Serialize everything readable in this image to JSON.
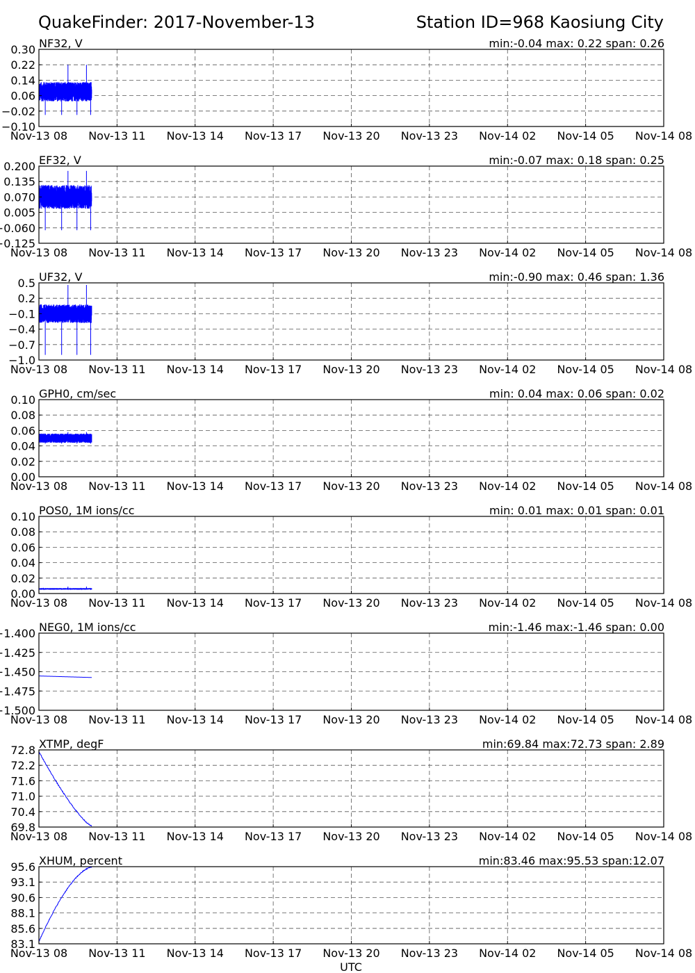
{
  "header": {
    "title": "QuakeFinder: 2017-November-13",
    "station": "Station ID=968  Kaosiung City"
  },
  "x_ticks": [
    "Nov-13 08",
    "Nov-13 11",
    "Nov-13 14",
    "Nov-13 17",
    "Nov-13 20",
    "Nov-13 23",
    "Nov-14 02",
    "Nov-14 05",
    "Nov-14 08"
  ],
  "xlabel": "UTC",
  "colors": {
    "series": "#0000ff",
    "grid": "#555555",
    "axis": "#000000"
  },
  "chart_data": [
    {
      "type": "line",
      "channel": "NF32, V",
      "stats": "min:-0.04 max: 0.22 span: 0.26",
      "yticks": [
        "0.30",
        "0.22",
        "0.14",
        "0.06",
        "−0.02",
        "−0.10"
      ],
      "ylim": [
        -0.1,
        0.3
      ],
      "x": "Nov-13 08 to ~Nov-13 10:40",
      "band": {
        "min": 0.03,
        "max": 0.13,
        "spike_min": -0.04,
        "spike_max": 0.22
      },
      "style": "noise"
    },
    {
      "type": "line",
      "channel": "EF32, V",
      "stats": "min:-0.07 max: 0.18 span: 0.25",
      "yticks": [
        "0.200",
        "0.135",
        "0.070",
        "0.005",
        "−0.060",
        "−0.125"
      ],
      "ylim": [
        -0.125,
        0.2
      ],
      "x": "Nov-13 08 to ~Nov-13 10:40",
      "band": {
        "min": 0.02,
        "max": 0.12,
        "spike_min": -0.07,
        "spike_max": 0.18
      },
      "style": "noise"
    },
    {
      "type": "line",
      "channel": "UF32, V",
      "stats": "min:-0.90 max: 0.46 span: 1.36",
      "yticks": [
        "0.5",
        "0.2",
        "−0.1",
        "−0.4",
        "−0.7",
        "−1.0"
      ],
      "ylim": [
        -1.0,
        0.5
      ],
      "x": "Nov-13 08 to ~Nov-13 10:40",
      "band": {
        "min": -0.28,
        "max": 0.08,
        "spike_min": -0.9,
        "spike_max": 0.46
      },
      "style": "noise"
    },
    {
      "type": "line",
      "channel": "GPH0, cm/sec",
      "stats": "min: 0.04 max: 0.06 span: 0.02",
      "yticks": [
        "0.10",
        "0.08",
        "0.06",
        "0.04",
        "0.02",
        "0.00"
      ],
      "ylim": [
        0.0,
        0.1
      ],
      "x": "Nov-13 08 to ~Nov-13 10:40",
      "band": {
        "min": 0.044,
        "max": 0.056,
        "spike_min": 0.043,
        "spike_max": 0.058
      },
      "style": "noise"
    },
    {
      "type": "line",
      "channel": "POS0, 1M ions/cc",
      "stats": "min: 0.01 max: 0.01 span: 0.01",
      "yticks": [
        "0.10",
        "0.08",
        "0.06",
        "0.04",
        "0.02",
        "0.00"
      ],
      "ylim": [
        0.0,
        0.1
      ],
      "x": "Nov-13 08 to ~Nov-13 10:40",
      "band": {
        "min": 0.005,
        "max": 0.007,
        "spike_min": 0.005,
        "spike_max": 0.009
      },
      "style": "noise"
    },
    {
      "type": "line",
      "channel": "NEG0, 1M ions/cc",
      "stats": "min:-1.46 max:-1.46 span: 0.00",
      "yticks": [
        "−1.400",
        "−1.425",
        "−1.450",
        "−1.475",
        "−1.500"
      ],
      "ylim": [
        -1.5,
        -1.4
      ],
      "x": "Nov-13 08 to ~Nov-13 10:40",
      "trend": {
        "start": -1.4555,
        "end": -1.4575
      },
      "style": "flat"
    },
    {
      "type": "line",
      "channel": "XTMP, degF",
      "stats": "min:69.84 max:72.73 span: 2.89",
      "yticks": [
        "72.8",
        "72.2",
        "71.6",
        "71.0",
        "70.4",
        "69.8"
      ],
      "ylim": [
        69.8,
        72.8
      ],
      "x": "Nov-13 08 to ~Nov-13 10:40",
      "trend": {
        "start": 72.73,
        "end": 69.84
      },
      "style": "falling"
    },
    {
      "type": "line",
      "channel": "XHUM, percent",
      "stats": "min:83.46 max:95.53 span:12.07",
      "yticks": [
        "95.6",
        "93.1",
        "90.6",
        "88.1",
        "85.6",
        "83.1"
      ],
      "ylim": [
        83.1,
        95.6
      ],
      "x": "Nov-13 08 to ~Nov-13 10:40",
      "trend": {
        "start": 83.46,
        "end": 95.53
      },
      "style": "rising"
    }
  ]
}
